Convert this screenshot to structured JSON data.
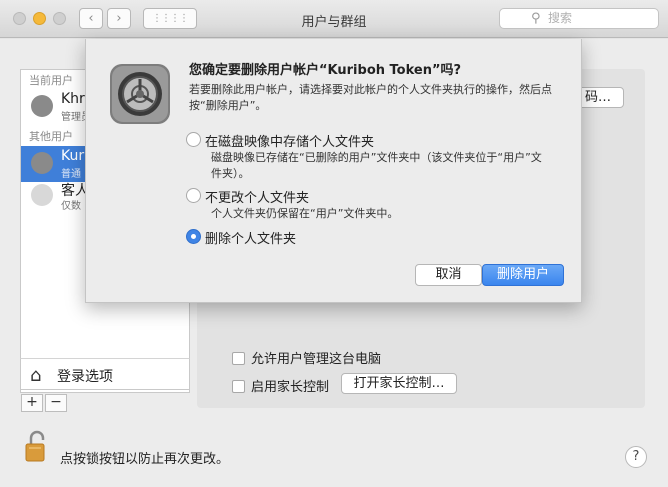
{
  "window": {
    "title": "用户与群组",
    "search_placeholder": "搜索",
    "nav_back": "‹",
    "nav_forward": "›",
    "grid_glyph": "⋮⋮⋮⋮"
  },
  "sidebar": {
    "current_user_header": "当前用户",
    "current_user": {
      "name": "Khro",
      "role": "管理员"
    },
    "other_users_header": "其他用户",
    "other_users": [
      {
        "name": "Kuri",
        "role": "普通",
        "selected": true
      },
      {
        "name": "客人",
        "role": "仅数",
        "selected": false
      }
    ],
    "login_options_label": "登录选项",
    "add_label": "+",
    "remove_label": "−"
  },
  "main": {
    "partial_button_label": "码…",
    "allow_admin_label": "允许用户管理这台电脑",
    "parental_controls_label": "启用家长控制",
    "open_parental_controls_label": "打开家长控制…"
  },
  "footer": {
    "lock_text": "点按锁按钮以防止再次更改。",
    "help_label": "?"
  },
  "dialog": {
    "title": "您确定要删除用户帐户“Kuriboh Token”吗?",
    "message": "若要删除此用户帐户，请选择要对此帐户的个人文件夹执行的操作，然后点按“删除用户”。",
    "options": [
      {
        "label": "在磁盘映像中存储个人文件夹",
        "description": "磁盘映像已存储在“已删除的用户”文件夹中（该文件夹位于“用户”文件夹）。",
        "selected": false
      },
      {
        "label": "不更改个人文件夹",
        "description": "个人文件夹仍保留在“用户”文件夹中。",
        "selected": false
      },
      {
        "label": "删除个人文件夹",
        "description": "",
        "selected": true
      }
    ],
    "cancel_label": "取消",
    "confirm_label": "删除用户"
  },
  "colors": {
    "accent": "#3f84e5",
    "selection": "#3f7fd9",
    "minimize": "#f5b93a"
  }
}
